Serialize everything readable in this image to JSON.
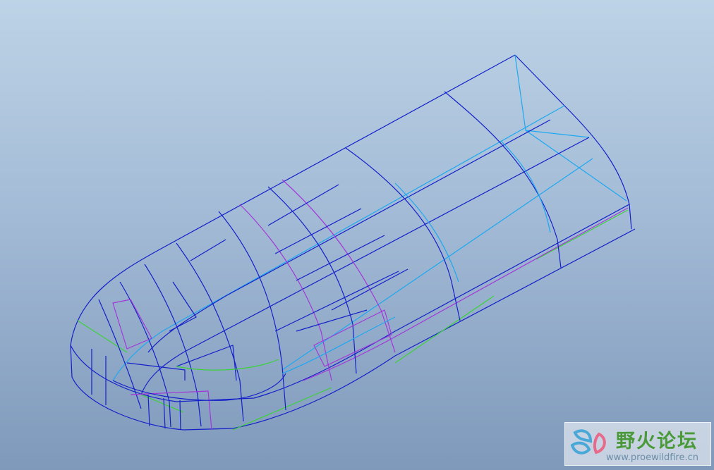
{
  "viewport": {
    "background_top": "#bdd3e6",
    "background_bottom": "#7f99bb"
  },
  "model": {
    "description_icon": "wireframe-hull-model",
    "edge_colors": {
      "dark_blue": "#1420c8",
      "cyan": "#1ea8f0",
      "purple": "#a238d8",
      "green": "#3ad23a"
    }
  },
  "watermark": {
    "title": "野火论坛",
    "url": "www.proewildfire.cn",
    "logo_icon": "butterfly-logo-icon",
    "title_color": "#4a9a3a",
    "url_color": "#6b8ea8"
  }
}
